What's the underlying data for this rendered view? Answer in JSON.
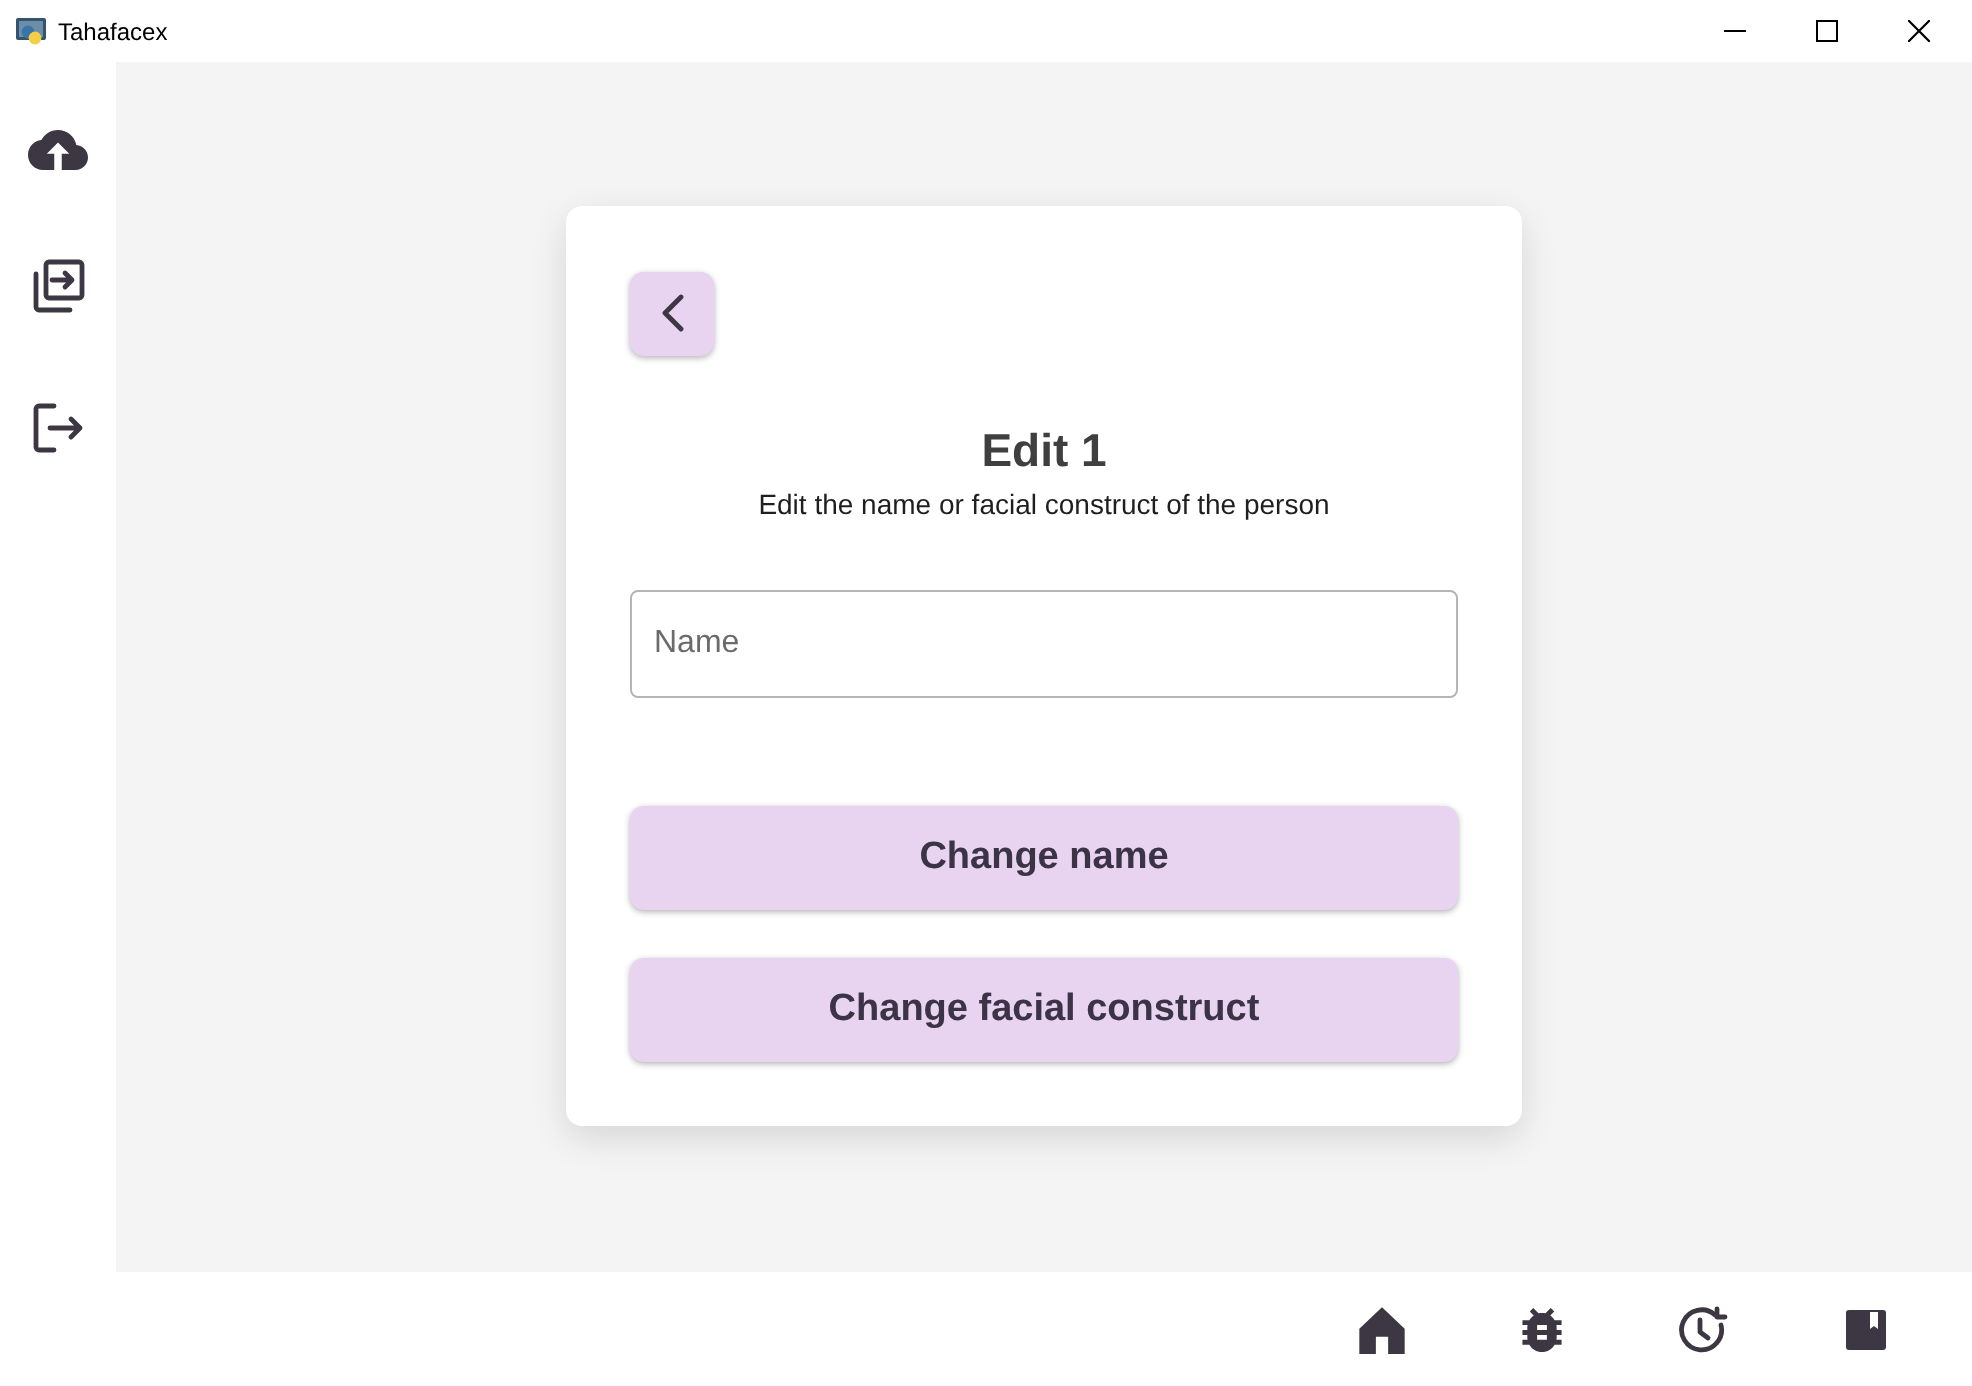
{
  "window": {
    "title": "Tahafacex"
  },
  "card": {
    "title": "Edit 1",
    "subtitle": "Edit the name or facial construct of the person",
    "name_field": {
      "placeholder": "Name"
    },
    "buttons": [
      "Change name",
      "Change facial construct"
    ]
  }
}
